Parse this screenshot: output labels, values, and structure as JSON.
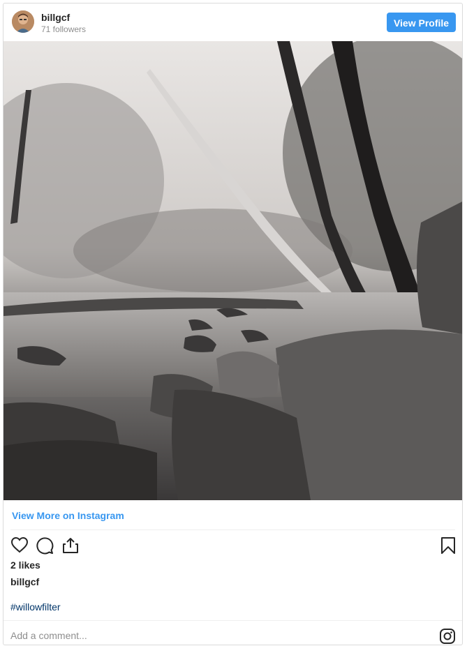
{
  "header": {
    "username": "billgcf",
    "followers": "71 followers",
    "view_profile_label": "View Profile",
    "accent_color": "#3897f0"
  },
  "post": {
    "image_icon": "photo-forest-river-bw",
    "view_more_label": "View More on Instagram",
    "actions": {
      "like_icon": "heart-icon",
      "comment_icon": "comment-icon",
      "share_icon": "share-icon",
      "save_icon": "bookmark-icon"
    },
    "likes": "2 likes",
    "caption_user": "billgcf",
    "hashtag": "#willowfilter"
  },
  "comment": {
    "placeholder": "Add a comment...",
    "brand_icon": "instagram-icon"
  }
}
